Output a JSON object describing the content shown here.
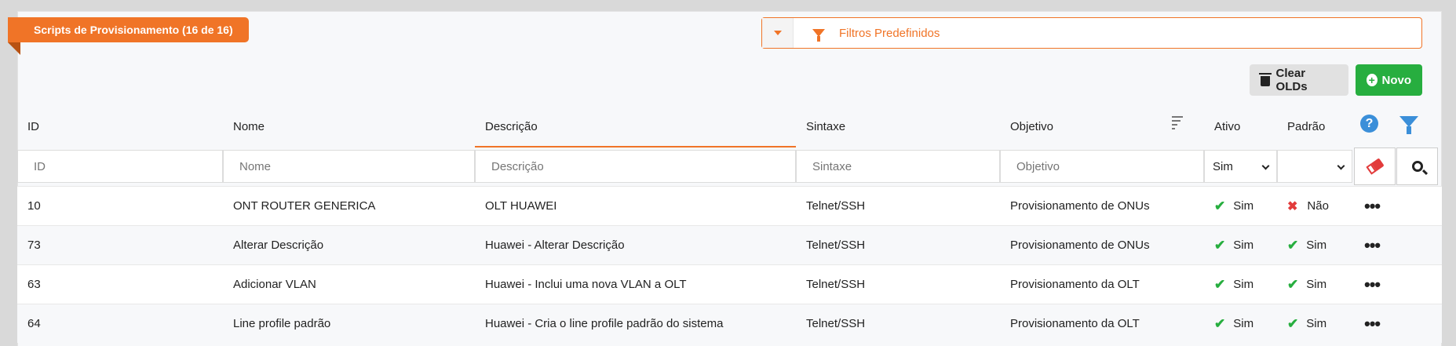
{
  "header": {
    "title": "Scripts de Provisionamento (16 de 16)",
    "filter_label": "Filtros Predefinidos"
  },
  "actions": {
    "clear_label": "Clear OLDs",
    "new_label": "Novo"
  },
  "columns": {
    "id": "ID",
    "nome": "Nome",
    "descricao": "Descrição",
    "sintaxe": "Sintaxe",
    "objetivo": "Objetivo",
    "ativo": "Ativo",
    "padrao": "Padrão"
  },
  "filters": {
    "id_placeholder": "ID",
    "nome_placeholder": "Nome",
    "descricao_placeholder": "Descrição",
    "sintaxe_placeholder": "Sintaxe",
    "objetivo_placeholder": "Objetivo",
    "ativo_value": "Sim",
    "padrao_value": ""
  },
  "rows": [
    {
      "id": "10",
      "nome": "ONT ROUTER GENERICA",
      "descricao": "OLT HUAWEI",
      "sintaxe": "Telnet/SSH",
      "objetivo": "Provisionamento de ONUs",
      "ativo": "Sim",
      "ativo_ok": true,
      "padrao": "Não",
      "padrao_ok": false
    },
    {
      "id": "73",
      "nome": "Alterar Descrição",
      "descricao": "Huawei - Alterar Descrição",
      "sintaxe": "Telnet/SSH",
      "objetivo": "Provisionamento de ONUs",
      "ativo": "Sim",
      "ativo_ok": true,
      "padrao": "Sim",
      "padrao_ok": true
    },
    {
      "id": "63",
      "nome": "Adicionar VLAN",
      "descricao": "Huawei - Inclui uma nova VLAN a OLT",
      "sintaxe": "Telnet/SSH",
      "objetivo": "Provisionamento da OLT",
      "ativo": "Sim",
      "ativo_ok": true,
      "padrao": "Sim",
      "padrao_ok": true
    },
    {
      "id": "64",
      "nome": "Line profile padrão",
      "descricao": "Huawei - Cria o line profile padrão do sistema",
      "sintaxe": "Telnet/SSH",
      "objetivo": "Provisionamento da OLT",
      "ativo": "Sim",
      "ativo_ok": true,
      "padrao": "Sim",
      "padrao_ok": true
    }
  ],
  "colors": {
    "accent": "#f07427",
    "success": "#27ae3f",
    "danger": "#e23b3b",
    "info": "#3b8fd9"
  },
  "icons": {
    "filter": "funnel-icon",
    "trash": "trash-icon",
    "add": "plus-circle-icon",
    "sort": "sort-icon",
    "help": "question-circle-icon",
    "eraser": "eraser-icon",
    "search": "search-icon",
    "menu": "more-dots-icon",
    "yes": "check-icon",
    "no": "x-icon"
  }
}
